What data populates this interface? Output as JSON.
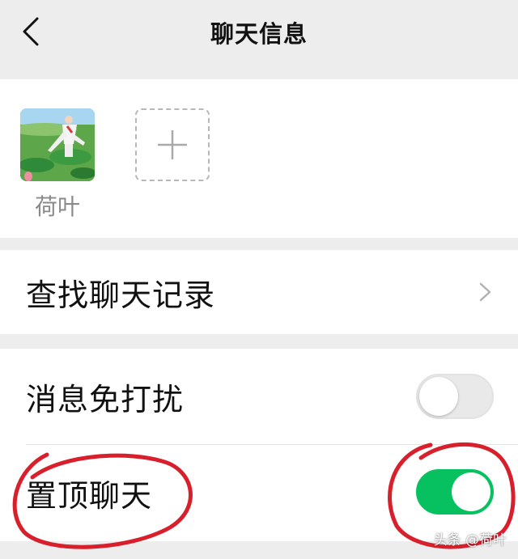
{
  "header": {
    "back_icon": "chevron-left-icon",
    "title": "聊天信息"
  },
  "members": {
    "contact_name": "荷叶",
    "add_icon": "plus-icon"
  },
  "rows": {
    "search_history": {
      "label": "查找聊天记录",
      "icon": "chevron-right-icon"
    },
    "mute": {
      "label": "消息免打扰",
      "enabled": false
    },
    "pin": {
      "label": "置顶聊天",
      "enabled": true
    }
  },
  "colors": {
    "toggle_on": "#07c160",
    "annotation": "#d8202c"
  },
  "watermark": "头条 @荷叶"
}
